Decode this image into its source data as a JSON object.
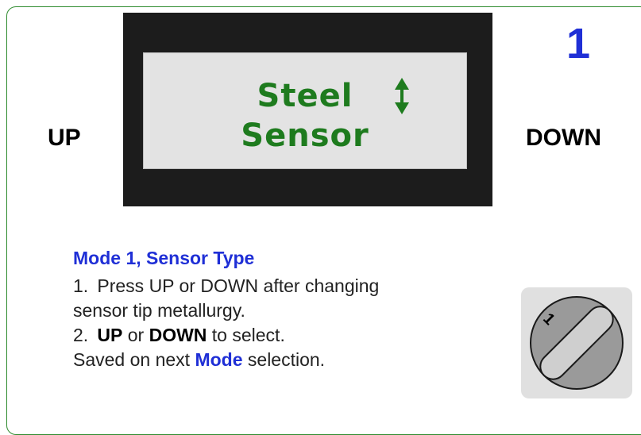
{
  "panel": {
    "up_label": "UP",
    "down_label": "DOWN",
    "mode_number": "1"
  },
  "lcd": {
    "line1": "Steel",
    "line2": "Sensor",
    "arrow_icon": "up-down-arrow-icon",
    "text_color": "#1e7b1e",
    "screen_color": "#e3e3e3",
    "bezel_color": "#1c1c1c"
  },
  "instructions": {
    "title": "Mode 1,  Sensor Type",
    "item1": {
      "number": "1.",
      "line1": "Press UP or DOWN after changing",
      "line2": "sensor tip metallurgy."
    },
    "item2": {
      "number": "2.",
      "up": "UP",
      "or": " or ",
      "down": "DOWN",
      "to_select": " to select.",
      "saved_prefix": "Saved on next ",
      "mode": "Mode",
      "saved_suffix": " selection."
    }
  },
  "knob": {
    "label": "1",
    "icon": "rotary-selector-knob-icon"
  },
  "colors": {
    "accent_blue": "#1f2fd6",
    "frame_green": "#2e8b2e"
  }
}
